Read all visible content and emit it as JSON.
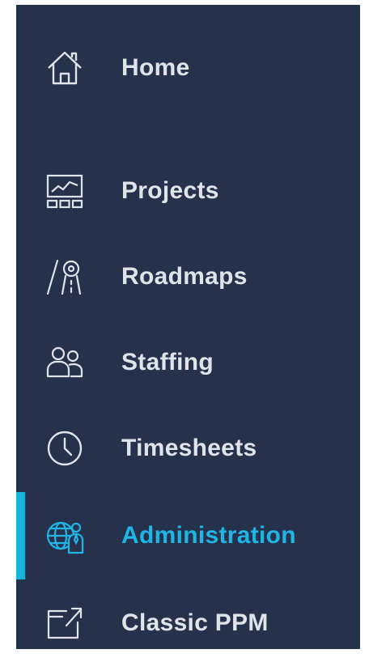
{
  "sidebar": {
    "accent_color": "#1fb6e6",
    "background_color": "#26314c",
    "text_color": "#dfe3ea",
    "items": [
      {
        "label": "Home",
        "icon": "home-icon",
        "active": false
      },
      {
        "label": "Projects",
        "icon": "projects-icon",
        "active": false
      },
      {
        "label": "Roadmaps",
        "icon": "roadmaps-icon",
        "active": false
      },
      {
        "label": "Staffing",
        "icon": "staffing-icon",
        "active": false
      },
      {
        "label": "Timesheets",
        "icon": "clock-icon",
        "active": false
      },
      {
        "label": "Administration",
        "icon": "administration-icon",
        "active": true
      },
      {
        "label": "Classic PPM",
        "icon": "external-link-icon",
        "active": false
      }
    ]
  }
}
